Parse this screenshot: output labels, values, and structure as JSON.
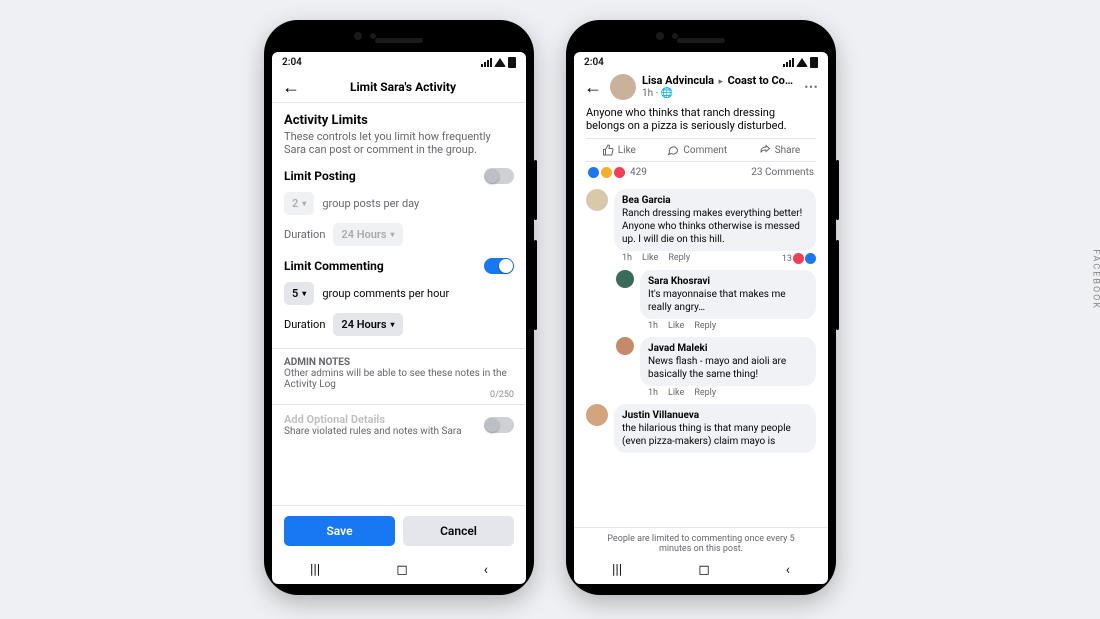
{
  "source_label": "FACEBOOK",
  "status": {
    "time": "2:04"
  },
  "left": {
    "nav_title": "Limit Sara's Activity",
    "heading": "Activity Limits",
    "sub": "These controls let you limit how frequently Sara can post or comment in the group.",
    "posting": {
      "title": "Limit Posting",
      "value": "2",
      "unit": "group posts per day",
      "duration_label": "Duration",
      "duration_value": "24 Hours"
    },
    "commenting": {
      "title": "Limit Commenting",
      "value": "5",
      "unit": "group comments per hour",
      "duration_label": "Duration",
      "duration_value": "24 Hours"
    },
    "admin_notes": {
      "title": "ADMIN NOTES",
      "desc": "Other admins will be able to see these notes in the Activity Log",
      "counter": "0/250"
    },
    "optional": {
      "title": "Add Optional Details",
      "desc": "Share violated rules and notes with Sara"
    },
    "save": "Save",
    "cancel": "Cancel"
  },
  "right": {
    "author": "Lisa Advincula",
    "group": "Coast to Co…",
    "time": "1h",
    "post": "Anyone who thinks that ranch dressing belongs on a pizza is seriously disturbed.",
    "like": "Like",
    "comment": "Comment",
    "share": "Share",
    "reaction_count": "429",
    "comment_count": "23 Comments",
    "c1": {
      "name": "Bea Garcia",
      "text": "Ranch dressing makes everything better! Anyone who thinks otherwise is messed up. I will die on this hill.",
      "time": "1h",
      "react": "13"
    },
    "c2": {
      "name": "Sara Khosravi",
      "text": "It's mayonnaise that makes me really angry…",
      "time": "1h"
    },
    "c3": {
      "name": "Javad Maleki",
      "text": "News flash - mayo and aioli are basically the same thing!",
      "time": "1h"
    },
    "c4": {
      "name": "Justin Villanueva",
      "text": "the hilarious thing is that many people (even pizza-makers) claim mayo is",
      "time": ""
    },
    "cm_like": "Like",
    "cm_reply": "Reply",
    "limit_note": "People are limited to commenting once every 5 minutes on this post."
  }
}
